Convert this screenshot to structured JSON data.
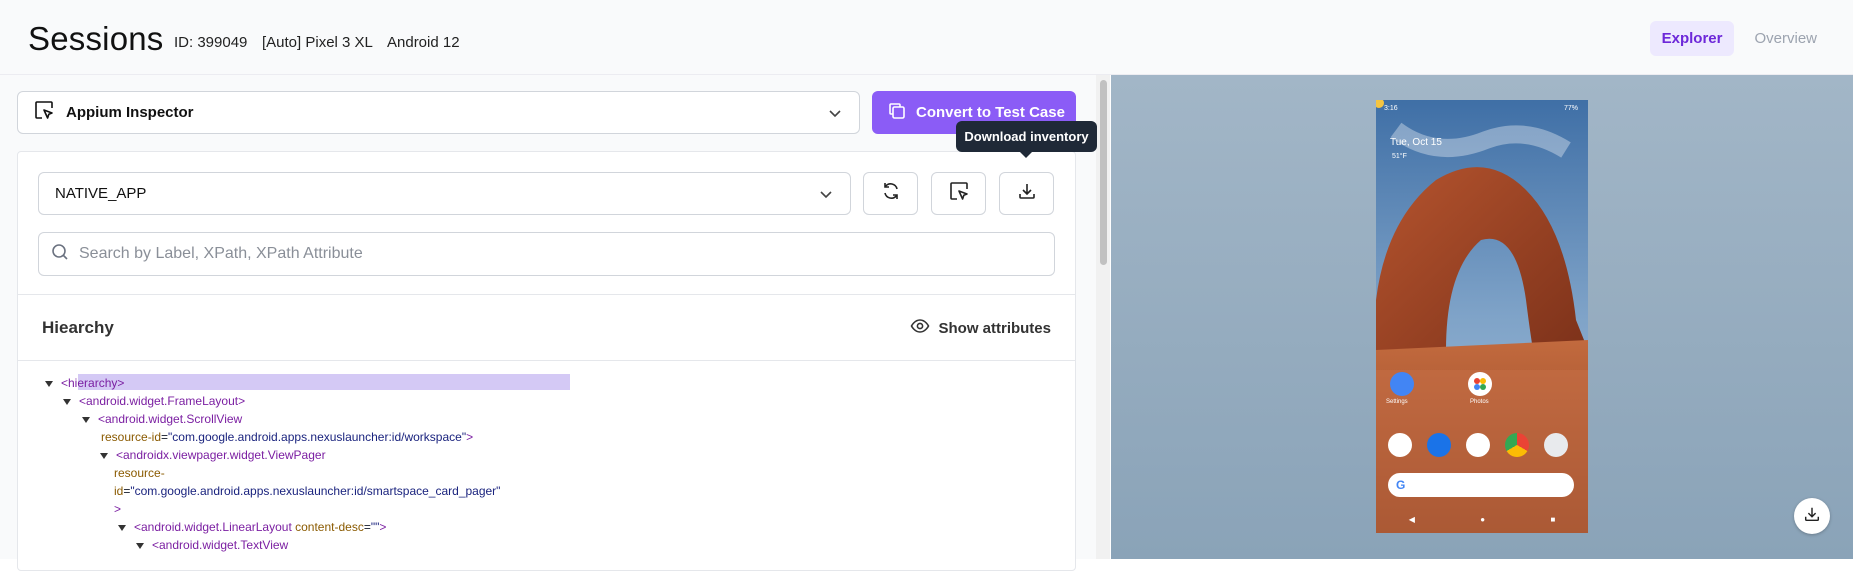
{
  "header": {
    "title": "Sessions",
    "session_id": "ID: 399049",
    "device": "[Auto] Pixel 3 XL",
    "os": "Android 12",
    "tabs": [
      {
        "label": "Explorer",
        "active": true
      },
      {
        "label": "Overview",
        "active": false
      }
    ]
  },
  "toolbar": {
    "tool_select_value": "Appium Inspector",
    "convert_label": "Convert to Test Case"
  },
  "inspector": {
    "context_value": "NATIVE_APP",
    "tooltip": "Download inventory",
    "search_placeholder": "Search by Label, XPath, XPath Attribute",
    "hierarchy_title": "Hiearchy",
    "show_attributes_label": "Show attributes"
  },
  "tree": {
    "n0_tag": "<hierarchy>",
    "n1_tag": "<android.widget.FrameLayout>",
    "n2_tag": "<android.widget.ScrollView",
    "n2_attr": "resource-id",
    "n2_val": "\"com.google.android.apps.nexuslauncher:id/workspace\"",
    "n2_close": ">",
    "n3_tag": "<androidx.viewpager.widget.ViewPager",
    "n3_attr_a": "resource-",
    "n3_attr_b": "id",
    "n3_val": "\"com.google.android.apps.nexuslauncher:id/smartspace_card_pager\"",
    "n3_close": ">",
    "n4_tag": "<android.widget.LinearLayout",
    "n4_attr": "content-desc",
    "n4_val": "\"\"",
    "n4_close": ">",
    "n5_tag": "<android.widget.TextView"
  },
  "device_screen": {
    "time": "3:16",
    "battery": "77%",
    "date": "Tue, Oct 15",
    "weather": "51°F",
    "apps_row1": [
      "Settings",
      "Photos"
    ],
    "dock_icons": [
      "phone-icon",
      "messages-icon",
      "play-store-icon",
      "chrome-icon",
      "camera-icon"
    ],
    "search_bar": "G"
  },
  "colors": {
    "accent": "#8b5cf6",
    "tab_active_bg": "#ede9fe",
    "tab_active_text": "#6d28d9",
    "highlight": "#d4c9f5"
  }
}
